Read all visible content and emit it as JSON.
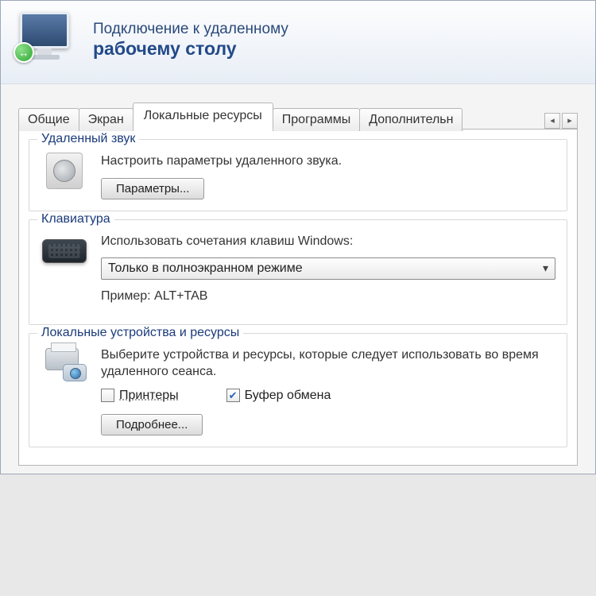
{
  "header": {
    "title_line1": "Подключение к удаленному",
    "title_line2": "рабочему столу",
    "badge_glyph": "↔"
  },
  "tabs": [
    {
      "label": "Общие",
      "active": false
    },
    {
      "label": "Экран",
      "active": false
    },
    {
      "label": "Локальные ресурсы",
      "active": true
    },
    {
      "label": "Программы",
      "active": false
    },
    {
      "label": "Дополнительн",
      "active": false
    }
  ],
  "tabscroll": {
    "left": "◂",
    "right": "▸"
  },
  "audio": {
    "legend": "Удаленный звук",
    "desc": "Настроить параметры удаленного звука.",
    "button": "Параметры..."
  },
  "keyboard": {
    "legend": "Клавиатура",
    "desc": "Использовать сочетания клавиш Windows:",
    "dropdown_value": "Только в полноэкранном режиме",
    "example": "Пример: ALT+TAB"
  },
  "local": {
    "legend": "Локальные устройства и ресурсы",
    "desc": "Выберите устройства и ресурсы, которые следует использовать во время удаленного сеанса.",
    "printers_label": "Принтеры",
    "printers_checked": false,
    "clipboard_label": "Буфер обмена",
    "clipboard_checked": true,
    "more_button": "Подробнее..."
  }
}
